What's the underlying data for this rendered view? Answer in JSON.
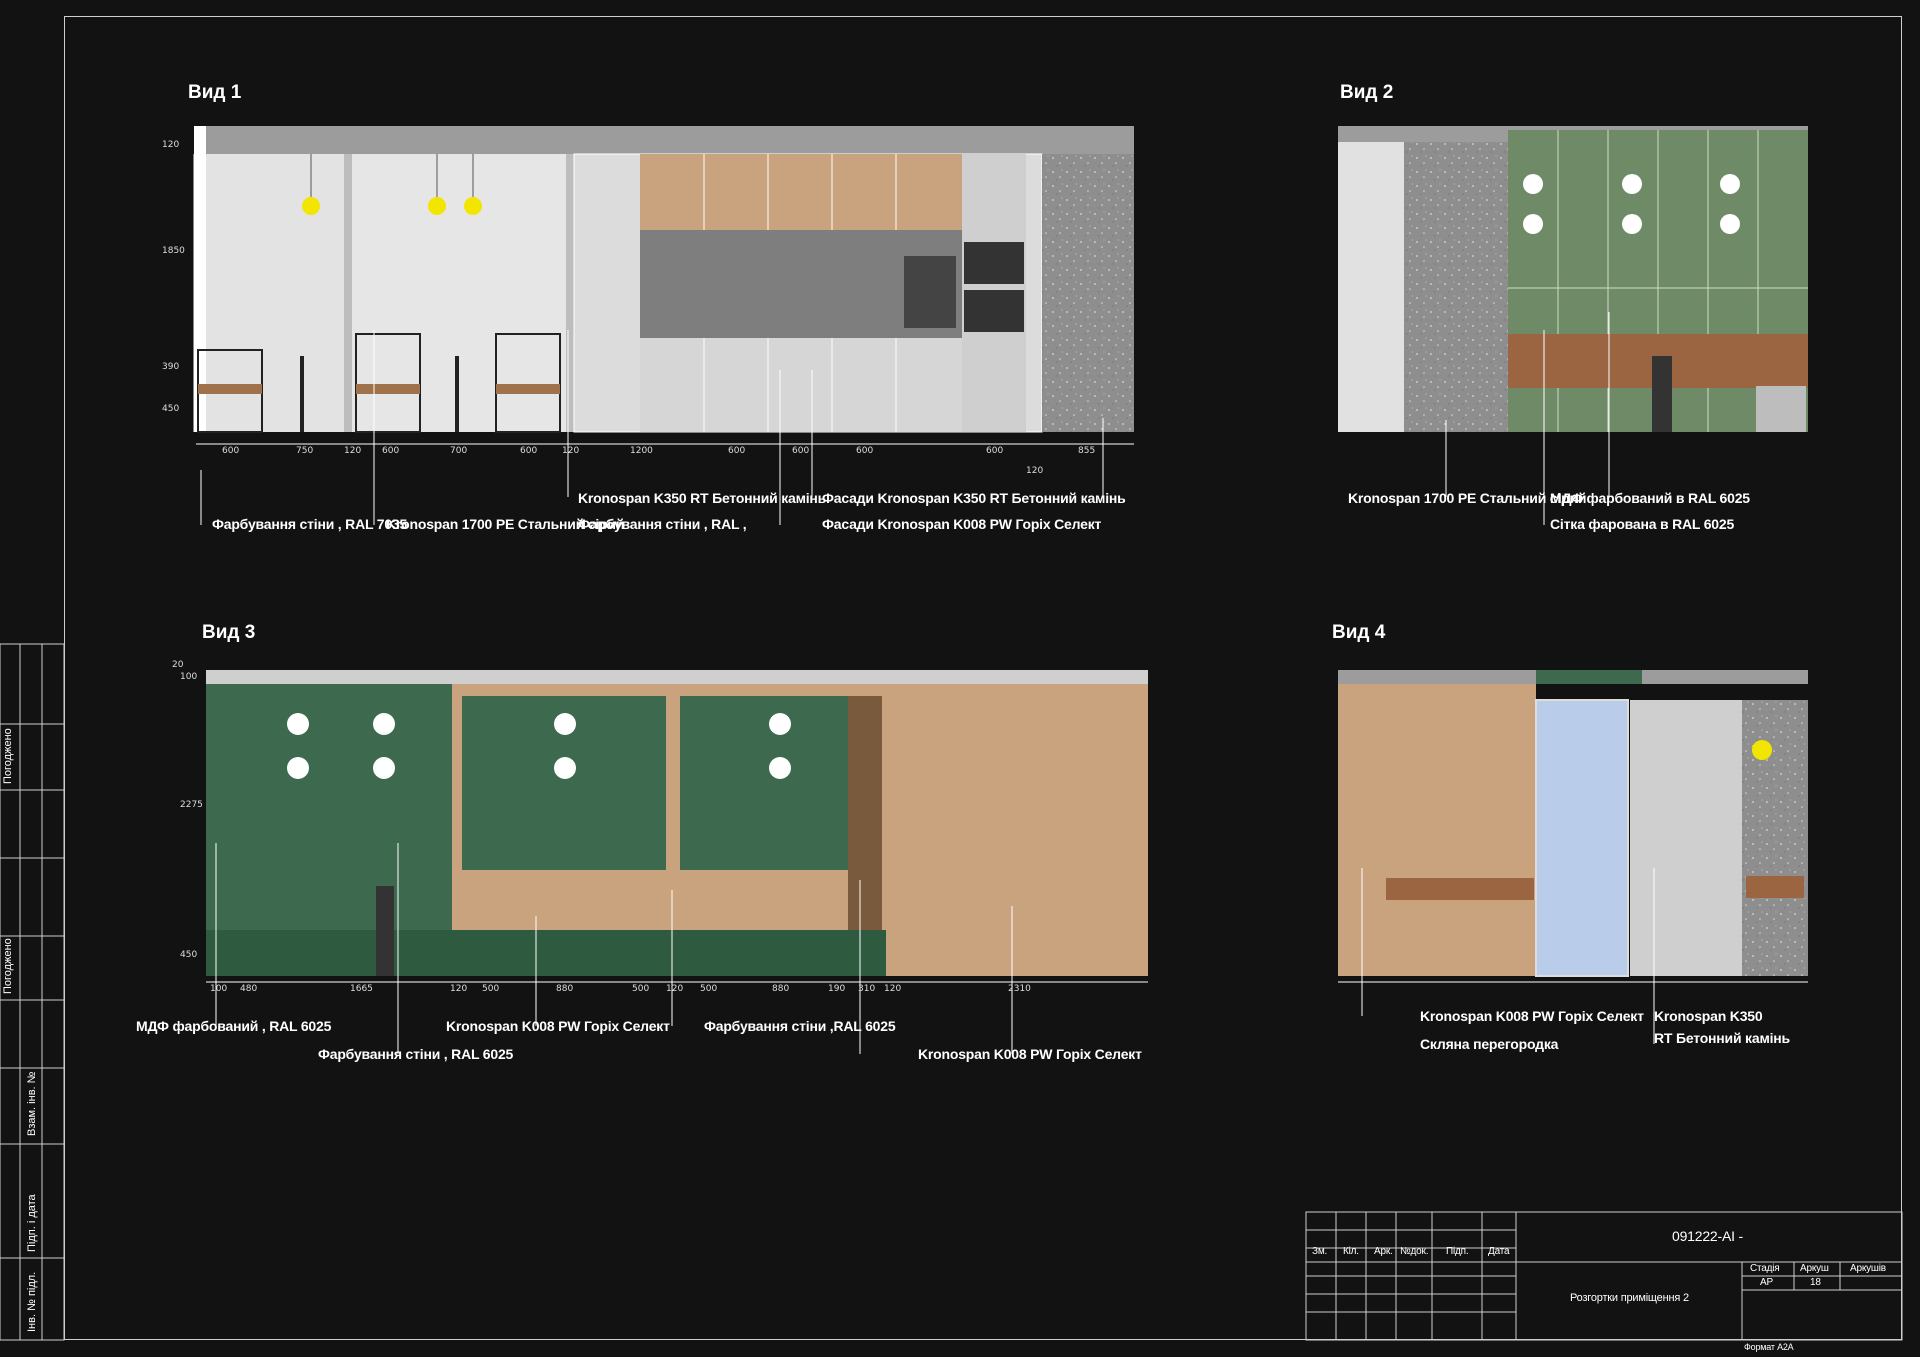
{
  "views": {
    "v1": {
      "title": "Вид 1",
      "labels": {
        "a": "Фарбування стіни , RAL 7035",
        "b": "Kronospan 1700 PE Стальний сірий",
        "c": "Фарбування стіни , RAL ,",
        "d": "Kronospan K350 RT Бетонний камінь",
        "e": "Фасади Kronospan K350 RT Бетонний камінь",
        "f": "Фасади Kronospan K008 PW Горіх Селект"
      },
      "dims_bottom": [
        "600",
        "750",
        "120",
        "600",
        "700",
        "600",
        "120",
        "1200",
        "600",
        "600",
        "600",
        "600",
        "855"
      ],
      "dim_extra": "120",
      "dims_left": [
        "120",
        "1850",
        "390",
        "450"
      ]
    },
    "v2": {
      "title": "Вид 2",
      "labels": {
        "a": "Kronospan 1700 PE Стальний сірий",
        "b": "МДФ фарбований в RAL 6025",
        "c": "Сітка фарована в RAL 6025"
      }
    },
    "v3": {
      "title": "Вид 3",
      "labels": {
        "a": "МДФ фарбований , RAL 6025",
        "b": "Фарбування стіни , RAL 6025",
        "c": "Kronospan K008 PW Горіх Селект",
        "d": "Фарбування стіни ,RAL 6025",
        "e": "Kronospan K008 PW Горіх Селект"
      },
      "dims_bottom": [
        "100",
        "480",
        "1665",
        "120",
        "500",
        "880",
        "500",
        "120",
        "500",
        "880",
        "190",
        "310",
        "120",
        "2310"
      ],
      "dims_left": [
        "20",
        "100",
        "2275",
        "450"
      ]
    },
    "v4": {
      "title": "Вид 4",
      "labels": {
        "a": "Kronospan K008 PW Горіх Селект",
        "b": "Скляна перегородка",
        "c": "Kronospan K350",
        "d": "RT Бетонний камінь"
      }
    }
  },
  "side_stamp": [
    "Погоджено",
    "Погоджено",
    "Взам. інв. №",
    "Підп. і дата",
    "Інв. № підл."
  ],
  "stamp": {
    "code": "091222-AI -",
    "headers": [
      "Зм.",
      "Кіл.",
      "Арк.",
      "№док.",
      "Підп.",
      "Дата"
    ],
    "sheet_title": "Розгортки приміщення 2",
    "stage_header": "Стадія",
    "sheet_header": "Аркуш",
    "sheets_header": "Аркушів",
    "stage": "АР",
    "sheet_no": "18",
    "format": "Формат А2А"
  },
  "colors": {
    "background": "#121212",
    "green": "#3f6a4f",
    "wood": "#c9a27e",
    "gray": "#cfcfcf",
    "concrete": "#8f8f8f",
    "glass": "#b9cdea"
  }
}
